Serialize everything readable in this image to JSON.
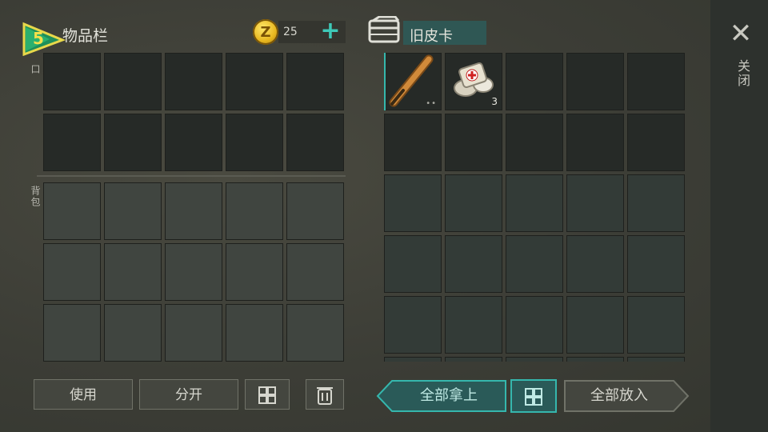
{
  "level_badge": {
    "value": "5"
  },
  "inventory": {
    "title": "物品栏",
    "side_label_top": "口",
    "side_label_bottom": "背包",
    "coins": {
      "icon": "coin-icon",
      "count": "25",
      "add_label": "+"
    }
  },
  "chest": {
    "icon": "chest-icon",
    "name": "旧皮卡",
    "items": [
      {
        "icon": "baseball-bat-icon",
        "extra": "••"
      },
      {
        "icon": "bandage-icon",
        "quantity": "3"
      }
    ]
  },
  "close": {
    "icon": "close-icon",
    "label": "关闭"
  },
  "buttons": {
    "use": "使用",
    "split": "分开",
    "sort_left_icon": "sort-grid-icon",
    "trash_icon": "trash-icon",
    "take_all": "全部拿上",
    "sort_right_icon": "sort-grid-icon",
    "put_all": "全部放入"
  },
  "colors": {
    "accent": "#35b7ad",
    "coin": "#e8b820",
    "badge": "#f4e04a"
  }
}
